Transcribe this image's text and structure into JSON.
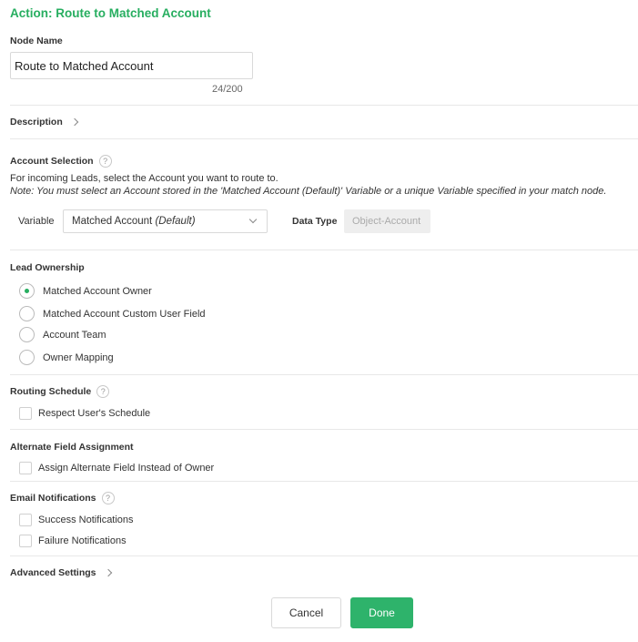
{
  "title": "Action: Route to Matched Account",
  "node_name": {
    "label": "Node Name",
    "value": "Route to Matched Account",
    "counter": "24/200"
  },
  "description": {
    "label": "Description"
  },
  "account_selection": {
    "label": "Account Selection",
    "help": "?",
    "instructions": "For incoming Leads, select the Account you want to route to.",
    "note": "Note: You must select an Account stored in the 'Matched Account (Default)' Variable or a unique Variable specified in your match node.",
    "variable_label": "Variable",
    "variable_value": "Matched Account",
    "variable_suffix": "(Default)",
    "data_type_label": "Data Type",
    "data_type_value": "Object-Account"
  },
  "lead_ownership": {
    "label": "Lead Ownership",
    "options": [
      {
        "label": "Matched Account Owner",
        "selected": true
      },
      {
        "label": "Matched Account Custom User Field",
        "selected": false
      },
      {
        "label": "Account Team",
        "selected": false
      },
      {
        "label": "Owner Mapping",
        "selected": false
      }
    ]
  },
  "routing_schedule": {
    "label": "Routing Schedule",
    "help": "?",
    "checkbox_label": "Respect User's Schedule"
  },
  "alternate_field": {
    "label": "Alternate Field Assignment",
    "checkbox_label": "Assign Alternate Field Instead of Owner"
  },
  "email_notifications": {
    "label": "Email Notifications",
    "help": "?",
    "success_label": "Success Notifications",
    "failure_label": "Failure Notifications"
  },
  "advanced_settings": {
    "label": "Advanced Settings"
  },
  "buttons": {
    "cancel": "Cancel",
    "done": "Done"
  },
  "colors": {
    "accent": "#27ae60",
    "done_button": "#2eb36b"
  }
}
